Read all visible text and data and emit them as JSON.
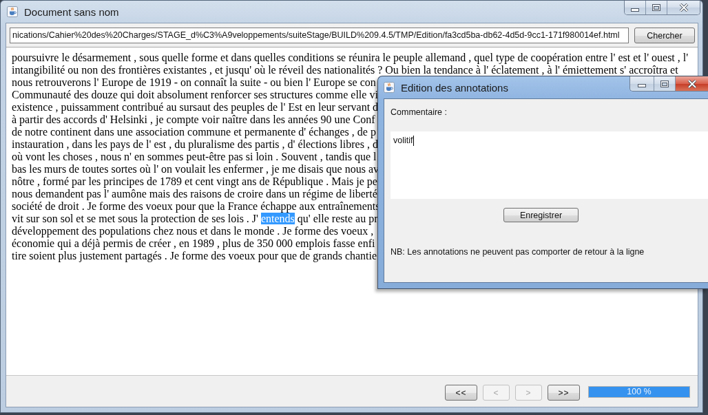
{
  "window": {
    "title": "Document sans nom",
    "active": false
  },
  "address_bar": {
    "value": "nications/Cahier%20des%20Charges/STAGE_d%C3%A9veloppements/suiteStage/BUILD%209.4.5/TMP/Edition/fa3cd5ba-db62-4d5d-9cc1-171f980014ef.html",
    "button": "Chercher"
  },
  "document": {
    "lines": [
      {
        "segments": [
          {
            "text": "poursuivre le désarmement , sous quelle forme et dans quelles conditions se réunira le peuple allemand , quel type de coopération entre l' est et l' ouest , l'",
            "selected": false
          }
        ]
      },
      {
        "segments": [
          {
            "text": "intangibilité ou non des frontières existantes , et jusqu' où le réveil des nationalités ? Ou bien la tendance à l' éclatement , à l' émiettement s' accroîtra et",
            "selected": false
          }
        ]
      },
      {
        "segments": [
          {
            "text": "nous retrouverons l' Europe de 1919 - on connaît la suite - ou bien l' Europe se con",
            "selected": false
          }
        ]
      },
      {
        "segments": [
          {
            "text": "Communauté des douze qui doit absolument renforcer ses structures comme elle vi",
            "selected": false
          }
        ]
      },
      {
        "segments": [
          {
            "text": "existence , puissamment contribué au sursaut des peuples de l' Est en leur servant d",
            "selected": false
          }
        ]
      },
      {
        "segments": [
          {
            "text": "à partir des accords d' Helsinki , je compte voir naître dans les années 90 une Conf",
            "selected": false
          }
        ]
      },
      {
        "segments": [
          {
            "text": "de notre continent dans une association commune et permanente d' échanges , de p",
            "selected": false
          }
        ]
      },
      {
        "segments": [
          {
            "text": "instauration , dans les pays de l' est , du pluralisme des partis , d' élections libres , d",
            "selected": false
          }
        ]
      },
      {
        "segments": [
          {
            "text": "où vont les choses , nous n' en sommes peut-être pas si loin . Souvent , tandis que l",
            "selected": false
          }
        ]
      },
      {
        "segments": [
          {
            "text": "bas les murs de toutes sortes où l' on voulait les enfermer , je me disais que nous av",
            "selected": false
          }
        ]
      },
      {
        "segments": [
          {
            "text": "nôtre , formé par les principes de 1789 et cent vingt ans de République . Mais je pe",
            "selected": false
          }
        ]
      },
      {
        "segments": [
          {
            "text": "nous demandent pas l' aumône mais des raisons de croire dans un régime de liberté",
            "selected": false
          }
        ]
      },
      {
        "segments": [
          {
            "text": "société de droit . Je forme des voeux pour que la France échappe aux entraînements",
            "selected": false
          }
        ]
      },
      {
        "segments": [
          {
            "text": "vit sur son sol et se met sous la protection de ses lois . J'",
            "selected": false
          },
          {
            "text": "entends",
            "selected": true
          },
          {
            "text": "qu' elle reste au pr",
            "selected": false
          }
        ]
      },
      {
        "segments": [
          {
            "text": "développement des populations chez nous et dans le monde . Je forme des voeux ,",
            "selected": false
          }
        ]
      },
      {
        "segments": [
          {
            "text": "économie qui a déjà permis de créer , en 1989 , plus de 350 000 emplois fasse enfi",
            "selected": false
          }
        ]
      },
      {
        "segments": [
          {
            "text": "tire soient plus justement partagés . Je forme des voeux pour que de grands chantie",
            "selected": false
          }
        ]
      }
    ]
  },
  "navigation": {
    "buttons": [
      {
        "label": "<<",
        "disabled": false
      },
      {
        "label": "<",
        "disabled": true
      },
      {
        "label": ">",
        "disabled": true
      },
      {
        "label": ">>",
        "disabled": false
      }
    ],
    "progress": {
      "level": 1,
      "label": "100 %"
    }
  },
  "dialog": {
    "title": "Edition des annotations",
    "active": true,
    "comment_label": "Commentaire :",
    "comment": {
      "value": "volitif",
      "focused": true
    },
    "save_button": "Enregistrer",
    "note": "NB: Les annotations ne peuvent pas comporter de retour à la ligne"
  }
}
